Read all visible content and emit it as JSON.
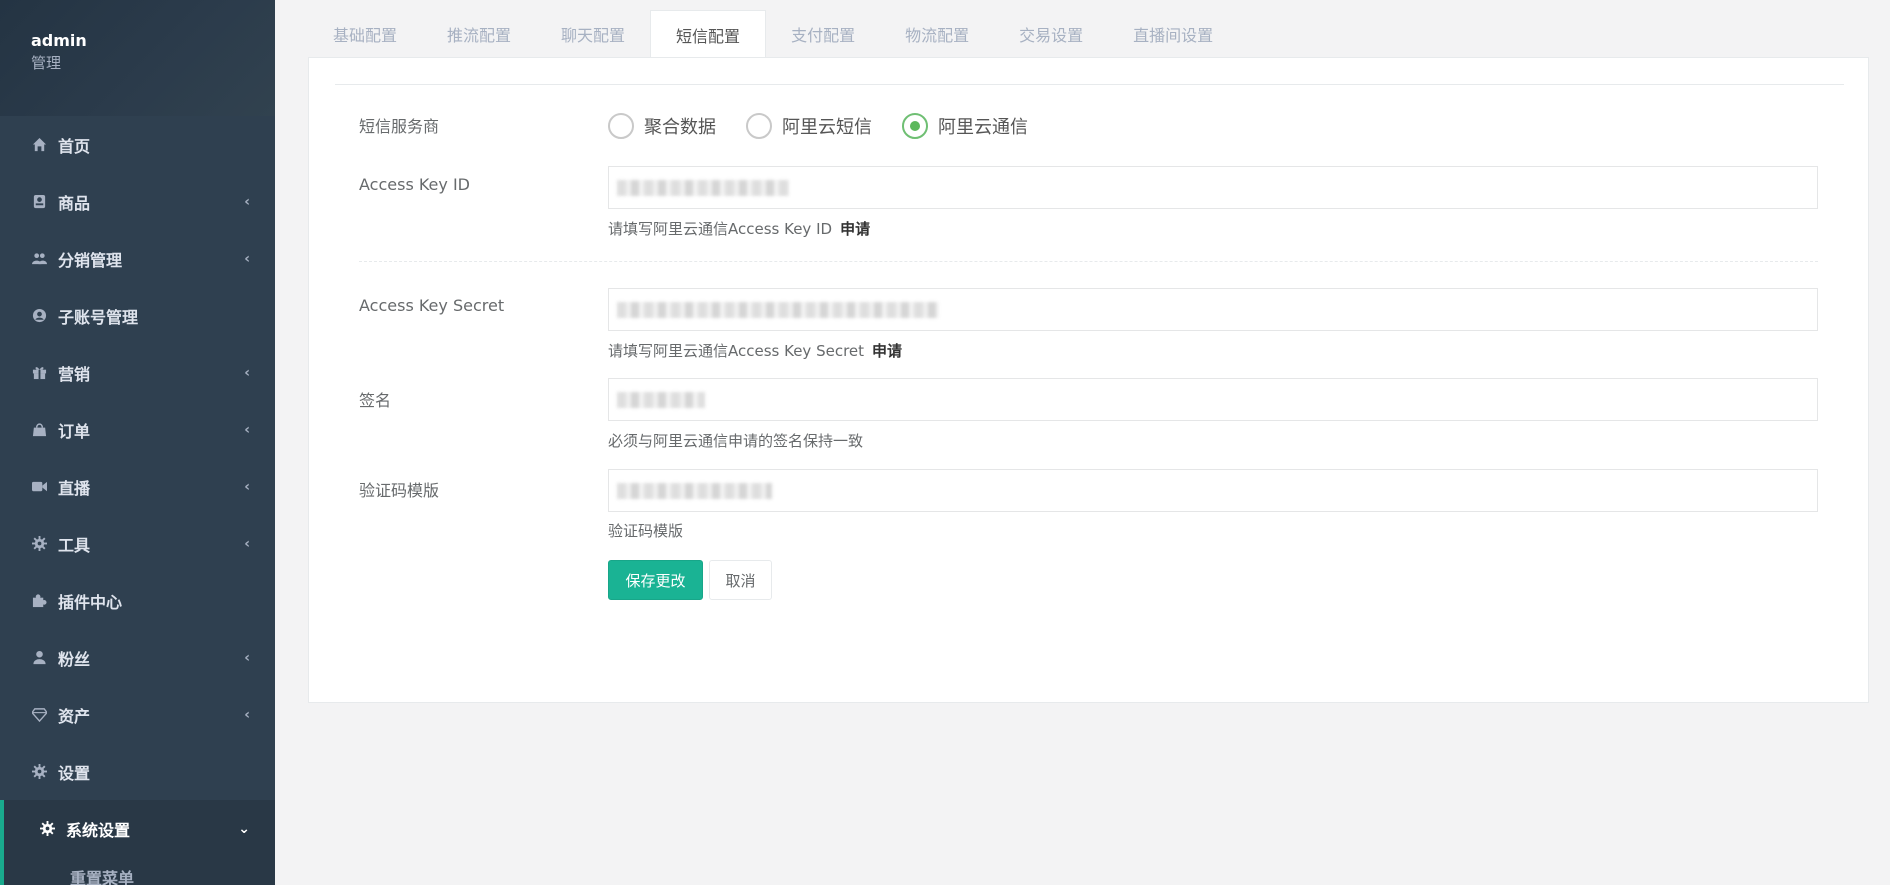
{
  "profile": {
    "name": "admin",
    "role": "管理"
  },
  "sidebar": {
    "items": [
      {
        "label": "首页",
        "icon": "home-icon",
        "has_arrow": false
      },
      {
        "label": "商品",
        "icon": "goods-icon",
        "has_arrow": true
      },
      {
        "label": "分销管理",
        "icon": "users-icon",
        "has_arrow": true
      },
      {
        "label": "子账号管理",
        "icon": "user-circle-icon",
        "has_arrow": false
      },
      {
        "label": "营销",
        "icon": "gift-icon",
        "has_arrow": true
      },
      {
        "label": "订单",
        "icon": "bag-icon",
        "has_arrow": true
      },
      {
        "label": "直播",
        "icon": "video-icon",
        "has_arrow": true
      },
      {
        "label": "工具",
        "icon": "gear-icon",
        "has_arrow": true
      },
      {
        "label": "插件中心",
        "icon": "puzzle-icon",
        "has_arrow": false
      },
      {
        "label": "粉丝",
        "icon": "user-icon",
        "has_arrow": true
      },
      {
        "label": "资产",
        "icon": "diamond-icon",
        "has_arrow": true
      },
      {
        "label": "设置",
        "icon": "gear-icon",
        "has_arrow": false
      },
      {
        "label": "系统设置",
        "icon": "gear-icon",
        "has_arrow": true,
        "expanded": true
      }
    ],
    "sub_items": [
      {
        "label": "重置菜单"
      }
    ],
    "arrow_glyph": "‹",
    "expanded_arrow_glyph": "⌄"
  },
  "tabs": [
    {
      "label": "基础配置"
    },
    {
      "label": "推流配置"
    },
    {
      "label": "聊天配置"
    },
    {
      "label": "短信配置",
      "active": true
    },
    {
      "label": "支付配置"
    },
    {
      "label": "物流配置"
    },
    {
      "label": "交易设置"
    },
    {
      "label": "直播间设置"
    }
  ],
  "form": {
    "provider": {
      "label": "短信服务商",
      "options": [
        "聚合数据",
        "阿里云短信",
        "阿里云通信"
      ],
      "selected": "阿里云通信"
    },
    "access_key_id": {
      "label": "Access Key ID",
      "help": "请填写阿里云通信Access Key ID",
      "apply": "申请"
    },
    "access_key_secret": {
      "label": "Access Key Secret",
      "help": "请填写阿里云通信Access Key Secret",
      "apply": "申请"
    },
    "signature": {
      "label": "签名",
      "help": "必须与阿里云通信申请的签名保持一致"
    },
    "template": {
      "label": "验证码模版",
      "help": "验证码模版"
    },
    "save_label": "保存更改",
    "cancel_label": "取消"
  },
  "colors": {
    "sidebar_bg": "#2f4050",
    "accent": "#1ab394",
    "radio_checked": "#5cb85c",
    "page_bg": "#f3f3f4"
  }
}
